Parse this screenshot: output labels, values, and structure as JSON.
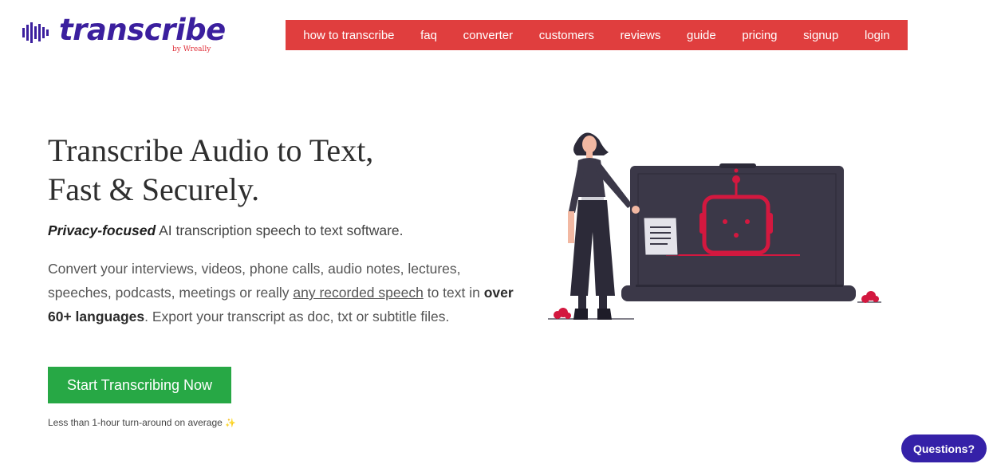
{
  "logo": {
    "text": "transcribe",
    "by": "by Wreally"
  },
  "nav": [
    {
      "label": "how to transcribe"
    },
    {
      "label": "faq"
    },
    {
      "label": "converter"
    },
    {
      "label": "customers"
    },
    {
      "label": "reviews"
    },
    {
      "label": "guide"
    },
    {
      "label": "pricing"
    },
    {
      "label": "signup"
    },
    {
      "label": "login"
    }
  ],
  "hero": {
    "headline_line1": "Transcribe Audio to Text,",
    "headline_line2": "Fast & Securely.",
    "sub_emphasis": "Privacy-focused",
    "sub_rest": " AI transcription speech to text software.",
    "desc_part1": "Convert your interviews, videos, phone calls, audio notes, lectures, speeches, podcasts, meetings or really ",
    "desc_link": "any recorded speech",
    "desc_part2": " to text in ",
    "desc_bold": "over 60+ languages",
    "desc_part3": ". Export your transcript as doc, txt or subtitle files.",
    "cta_label": "Start Transcribing Now",
    "note": "Less than 1-hour turn-around on average",
    "note_icon": "sparkle-icon"
  },
  "chat": {
    "label": "Questions?"
  },
  "colors": {
    "brand": "#3b1f9e",
    "nav_bg": "#e03e3e",
    "cta": "#27a845",
    "chat": "#3521a8",
    "accent_red": "#d3183f"
  }
}
